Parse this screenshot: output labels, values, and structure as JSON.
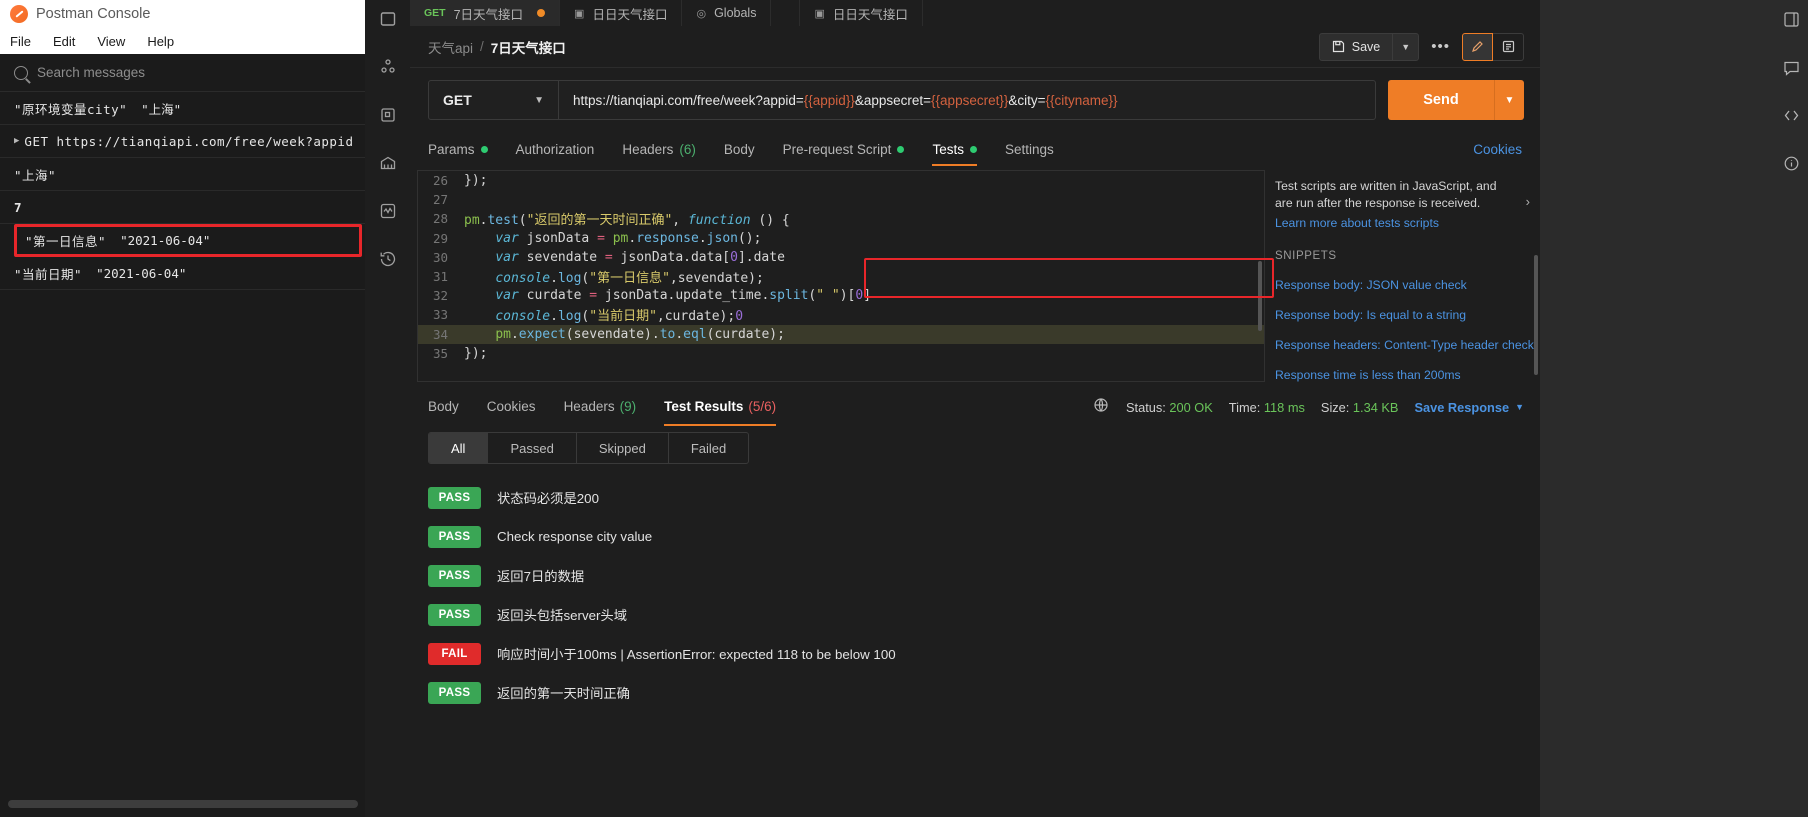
{
  "console": {
    "title": "Postman Console",
    "menu": [
      "File",
      "Edit",
      "View",
      "Help"
    ],
    "search_placeholder": "Search messages",
    "logs": [
      {
        "key": "\"原环境变量city\"",
        "value": "\"上海\"",
        "caret": false,
        "bold": false,
        "highlight": false
      },
      {
        "key": "GET https://tianqiapi.com/free/week?appid",
        "value": "",
        "caret": true,
        "bold": false,
        "highlight": false
      },
      {
        "key": "\"上海\"",
        "value": "",
        "caret": false,
        "bold": false,
        "highlight": false
      },
      {
        "key": "7",
        "value": "",
        "caret": false,
        "bold": true,
        "highlight": false
      },
      {
        "key": "\"第一日信息\"",
        "value": "\"2021-06-04\"",
        "caret": false,
        "bold": false,
        "highlight": true
      },
      {
        "key": "\"当前日期\"",
        "value": "\"2021-06-04\"",
        "caret": false,
        "bold": false,
        "highlight": false
      }
    ]
  },
  "app": {
    "tabs": [
      {
        "method": "GET",
        "label": "7日天气接口",
        "active": true,
        "unsaved": true,
        "icon": ""
      },
      {
        "method": "",
        "label": "日日天气接口",
        "active": false,
        "unsaved": false,
        "icon": "collection-icon"
      },
      {
        "method": "",
        "label": "Globals",
        "active": false,
        "unsaved": false,
        "icon": "globe-icon"
      },
      {
        "method": "",
        "label": "",
        "active": false,
        "unsaved": false,
        "icon": ""
      },
      {
        "method": "",
        "label": "日日天气接口",
        "active": false,
        "unsaved": false,
        "icon": "collection-icon"
      }
    ],
    "breadcrumb": {
      "parent": "天气api",
      "separator": "/",
      "current": "7日天气接口"
    },
    "save_label": "Save",
    "more_label": "•••",
    "url_bar": {
      "method": "GET",
      "url_parts": [
        {
          "text": "https://tianqiapi.com/free/week?appid=",
          "variable": false
        },
        {
          "text": "{{appid}}",
          "variable": true
        },
        {
          "text": "&appsecret=",
          "variable": false
        },
        {
          "text": "{{appsecret}}",
          "variable": true
        },
        {
          "text": "&city=",
          "variable": false
        },
        {
          "text": "{{cityname}}",
          "variable": true
        }
      ],
      "send_label": "Send"
    },
    "request_tabs": [
      {
        "label": "Params",
        "dot": true,
        "count": "",
        "active": false
      },
      {
        "label": "Authorization",
        "dot": false,
        "count": "",
        "active": false
      },
      {
        "label": "Headers",
        "dot": false,
        "count": "(6)",
        "active": false
      },
      {
        "label": "Body",
        "dot": false,
        "count": "",
        "active": false
      },
      {
        "label": "Pre-request Script",
        "dot": true,
        "count": "",
        "active": false
      },
      {
        "label": "Tests",
        "dot": true,
        "count": "",
        "active": true
      },
      {
        "label": "Settings",
        "dot": false,
        "count": "",
        "active": false
      }
    ],
    "cookies_link": "Cookies",
    "editor": {
      "lines": [
        {
          "no": "26",
          "code": "});",
          "current": false
        },
        {
          "no": "27",
          "code": "",
          "current": false
        },
        {
          "no": "28",
          "code": "pm.test(\"返回的第一天时间正确\", function () {",
          "current": false
        },
        {
          "no": "29",
          "code": "    var jsonData = pm.response.json();",
          "current": false
        },
        {
          "no": "30",
          "code": "    var sevendate = jsonData.data[0].date",
          "current": false
        },
        {
          "no": "31",
          "code": "    console.log(\"第一日信息\",sevendate);",
          "current": false
        },
        {
          "no": "32",
          "code": "    var curdate = jsonData.update_time.split(\" \")[0]",
          "current": false
        },
        {
          "no": "33",
          "code": "    console.log(\"当前日期\",curdate);0",
          "current": false
        },
        {
          "no": "34",
          "code": "    pm.expect(sevendate).to.eql(curdate);",
          "current": true
        },
        {
          "no": "35",
          "code": "});",
          "current": false
        }
      ]
    },
    "snippets": {
      "description": "Test scripts are written in JavaScript, and are run after the response is received.",
      "learn_more": "Learn more about tests scripts",
      "heading": "SNIPPETS",
      "items": [
        "Response body: JSON value check",
        "Response body: Is equal to a string",
        "Response headers: Content-Type header check",
        "Response time is less than 200ms"
      ]
    },
    "response": {
      "tabs": [
        {
          "label": "Body",
          "count": "",
          "count_color": "",
          "active": false
        },
        {
          "label": "Cookies",
          "count": "",
          "count_color": "",
          "active": false
        },
        {
          "label": "Headers",
          "count": "(9)",
          "count_color": "green",
          "active": false
        },
        {
          "label": "Test Results",
          "count": "(5/6)",
          "count_color": "red",
          "active": true
        }
      ],
      "meta": {
        "status_label": "Status:",
        "status_value": "200 OK",
        "time_label": "Time:",
        "time_value": "118 ms",
        "size_label": "Size:",
        "size_value": "1.34 KB"
      },
      "save_response": "Save Response",
      "filters": [
        {
          "label": "All",
          "active": true
        },
        {
          "label": "Passed",
          "active": false
        },
        {
          "label": "Skipped",
          "active": false
        },
        {
          "label": "Failed",
          "active": false
        }
      ],
      "results": [
        {
          "status": "PASS",
          "name": "状态码必须是200"
        },
        {
          "status": "PASS",
          "name": "Check response city value"
        },
        {
          "status": "PASS",
          "name": "返回7日的数据"
        },
        {
          "status": "PASS",
          "name": "返回头包括server头域"
        },
        {
          "status": "FAIL",
          "name": "响应时间小于100ms | AssertionError: expected 118 to be below 100"
        },
        {
          "status": "PASS",
          "name": "返回的第一天时间正确"
        }
      ]
    }
  },
  "colors": {
    "accent_orange": "#ef7d26",
    "pass_green": "#3aa655",
    "fail_red": "#e02b2b",
    "link_blue": "#4b93e2",
    "highlight_red": "#e8262a"
  }
}
